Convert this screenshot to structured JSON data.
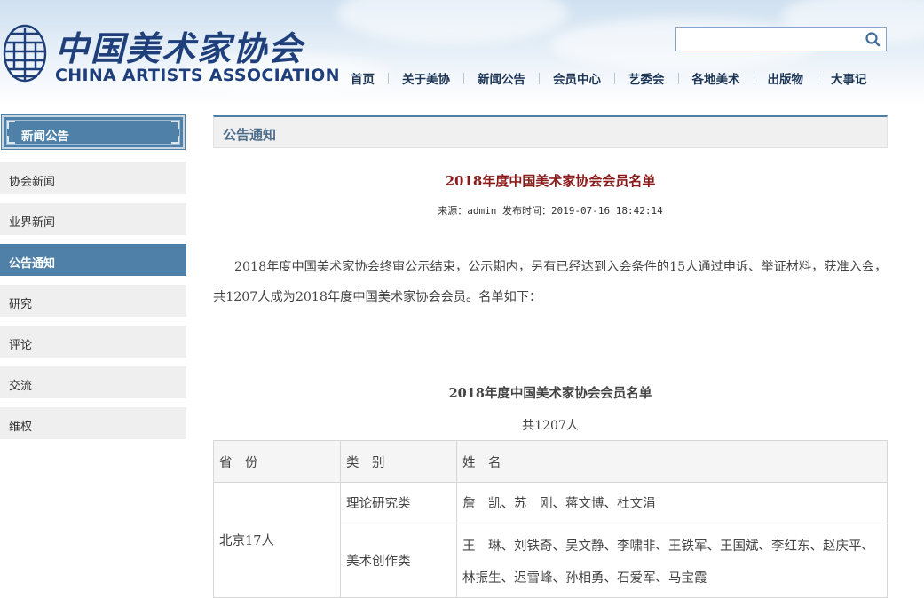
{
  "header": {
    "logo_cn": "中国美术家协会",
    "logo_en": "CHINA ARTISTS ASSOCIATION",
    "search": {
      "value": "",
      "placeholder": ""
    },
    "nav": [
      "首页",
      "关于美协",
      "新闻公告",
      "会员中心",
      "艺委会",
      "各地美术",
      "出版物",
      "大事记"
    ]
  },
  "sidebar": {
    "heading": "新闻公告",
    "items": [
      {
        "label": "协会新闻",
        "active": false
      },
      {
        "label": "业界新闻",
        "active": false
      },
      {
        "label": "公告通知",
        "active": true
      },
      {
        "label": "研究",
        "active": false
      },
      {
        "label": "评论",
        "active": false
      },
      {
        "label": "交流",
        "active": false
      },
      {
        "label": "维权",
        "active": false
      }
    ]
  },
  "main": {
    "section_title": "公告通知",
    "article": {
      "title": "2018年度中国美术家协会会员名单",
      "meta": "来源：admin 发布时间：2019-07-16 18:42:14",
      "paragraph": "2018年度中国美术家协会终审公示结束，公示期内，另有已经达到入会条件的15人通过申诉、举证材料，获准入会，共1207人成为2018年度中国美术家协会会员。名单如下：",
      "list_title": "2018年度中国美术家协会会员名单",
      "list_count": "共1207人"
    },
    "table": {
      "headers": [
        "省　份",
        "类　别",
        "姓　名"
      ],
      "rows": [
        {
          "province": "北京17人",
          "category": "理论研究类",
          "names": "詹　凯、苏　刚、蒋文博、杜文涓"
        },
        {
          "province": "",
          "category": "美术创作类",
          "names": "王　琳、刘铁奇、吴文静、李啸非、王铁军、王国斌、李红东、赵庆平、林振生、迟雪峰、孙相勇、石爱军、马宝霞"
        }
      ]
    }
  },
  "colors": {
    "accent": "#4e80a8",
    "title_red": "#8b1b1b",
    "logo_blue": "#1f3f7a"
  }
}
